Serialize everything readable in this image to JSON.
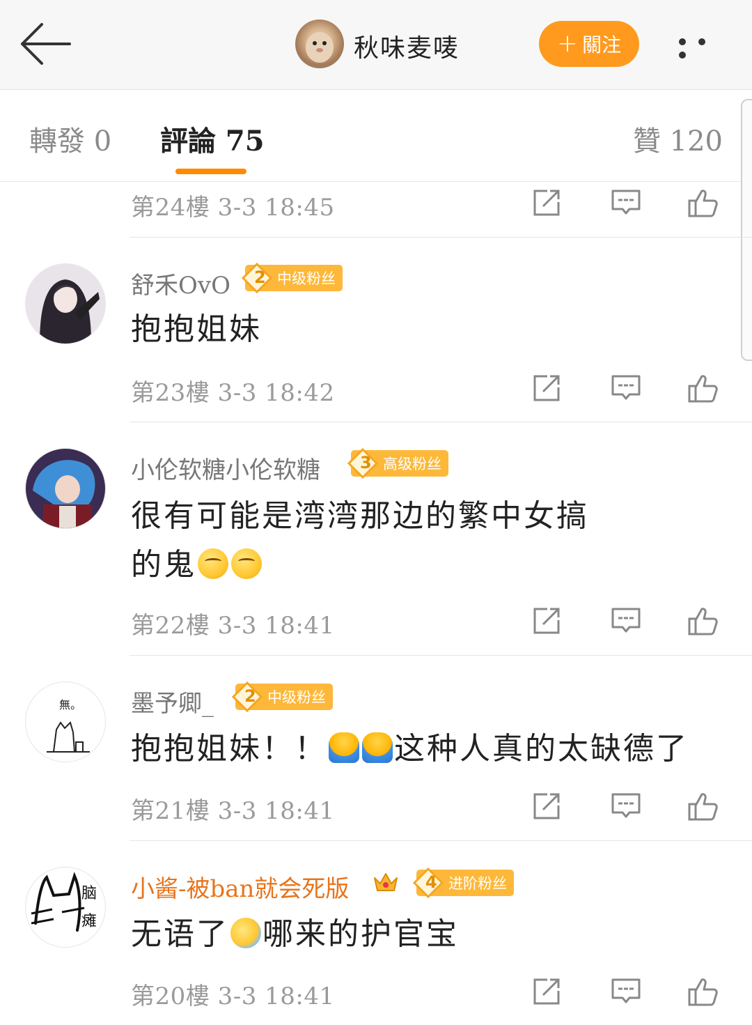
{
  "header": {
    "back_label": "back",
    "username": "秋味麦唛",
    "follow_label": "關注"
  },
  "tabs": {
    "repost": "轉發 0",
    "comments": "評論 75",
    "likes": "贊 120"
  },
  "floors": {
    "f24": "第24樓 3-3 18:45",
    "f23": "第23樓 3-3 18:42",
    "f22": "第22樓 3-3 18:41",
    "f21": "第21樓 3-3 18:41",
    "f20": "第20樓 3-3 18:41"
  },
  "comments": [
    {
      "name": "舒禾OvO",
      "badge_level": "2",
      "badge_label": "中级粉丝",
      "text": "抱抱姐妹"
    },
    {
      "name": "小伦软糖小伦软糖",
      "badge_level": "3",
      "badge_label": "高级粉丝",
      "text_line1": "很有可能是湾湾那边的繁中女搞",
      "text_line2": "的鬼"
    },
    {
      "name": "墨予卿_",
      "badge_level": "2",
      "badge_label": "中级粉丝",
      "text_a": "抱抱姐妹！！",
      "text_b": "这种人真的太缺德了"
    },
    {
      "name": "小酱-被ban就会死版",
      "badge_level": "4",
      "badge_label": "进阶粉丝",
      "text_a": "无语了",
      "text_b": "哪来的护官宝"
    }
  ],
  "colors": {
    "accent": "#ff8a00",
    "follow_bg": "#ff9a1e",
    "badge_bg": "#fdb83a",
    "vip_name": "#e8741b"
  },
  "icons": {
    "back": "arrow-left-icon",
    "more": "more-dots-icon",
    "repost": "share-edit-icon",
    "reply": "comment-icon",
    "like": "thumbs-up-icon"
  }
}
